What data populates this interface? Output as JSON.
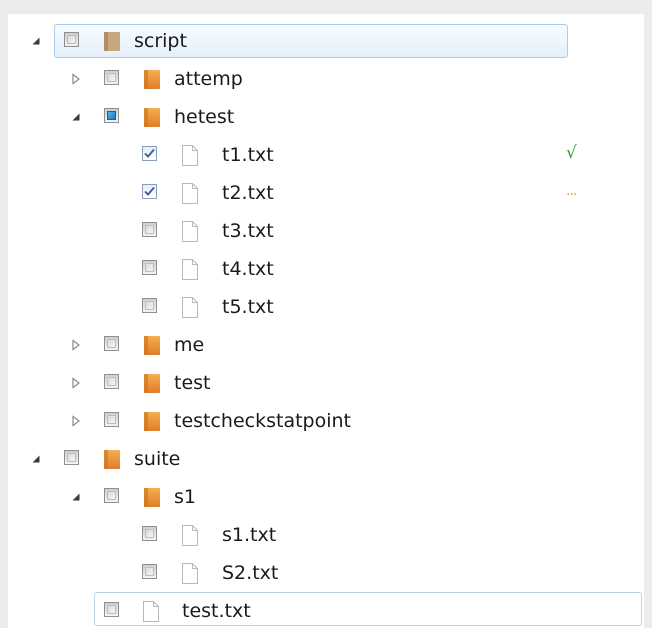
{
  "tree": {
    "script": {
      "label": "script"
    },
    "attemp": {
      "label": "attemp"
    },
    "hetest": {
      "label": "hetest"
    },
    "t1": {
      "label": "t1.txt",
      "status": "√"
    },
    "t2": {
      "label": "t2.txt",
      "status": "..."
    },
    "t3": {
      "label": "t3.txt"
    },
    "t4": {
      "label": "t4.txt"
    },
    "t5": {
      "label": "t5.txt"
    },
    "me": {
      "label": "me"
    },
    "test": {
      "label": "test"
    },
    "testcheckstatpoint": {
      "label": "testcheckstatpoint"
    },
    "suite": {
      "label": "suite"
    },
    "s1": {
      "label": "s1"
    },
    "s1txt": {
      "label": "s1.txt"
    },
    "s2txt": {
      "label": "S2.txt"
    },
    "testtxt": {
      "label": "test.txt"
    }
  },
  "colors": {
    "selection_border": "#a9cdef",
    "folder": "#e58a2e",
    "status_ok": "#2aa52a",
    "status_pending": "#e6a43b"
  },
  "icons": {
    "expanded": "expanded-triangle-icon",
    "collapsed": "collapsed-triangle-icon",
    "folder": "folder-icon",
    "file": "file-icon",
    "checkbox": "checkbox-icon"
  }
}
